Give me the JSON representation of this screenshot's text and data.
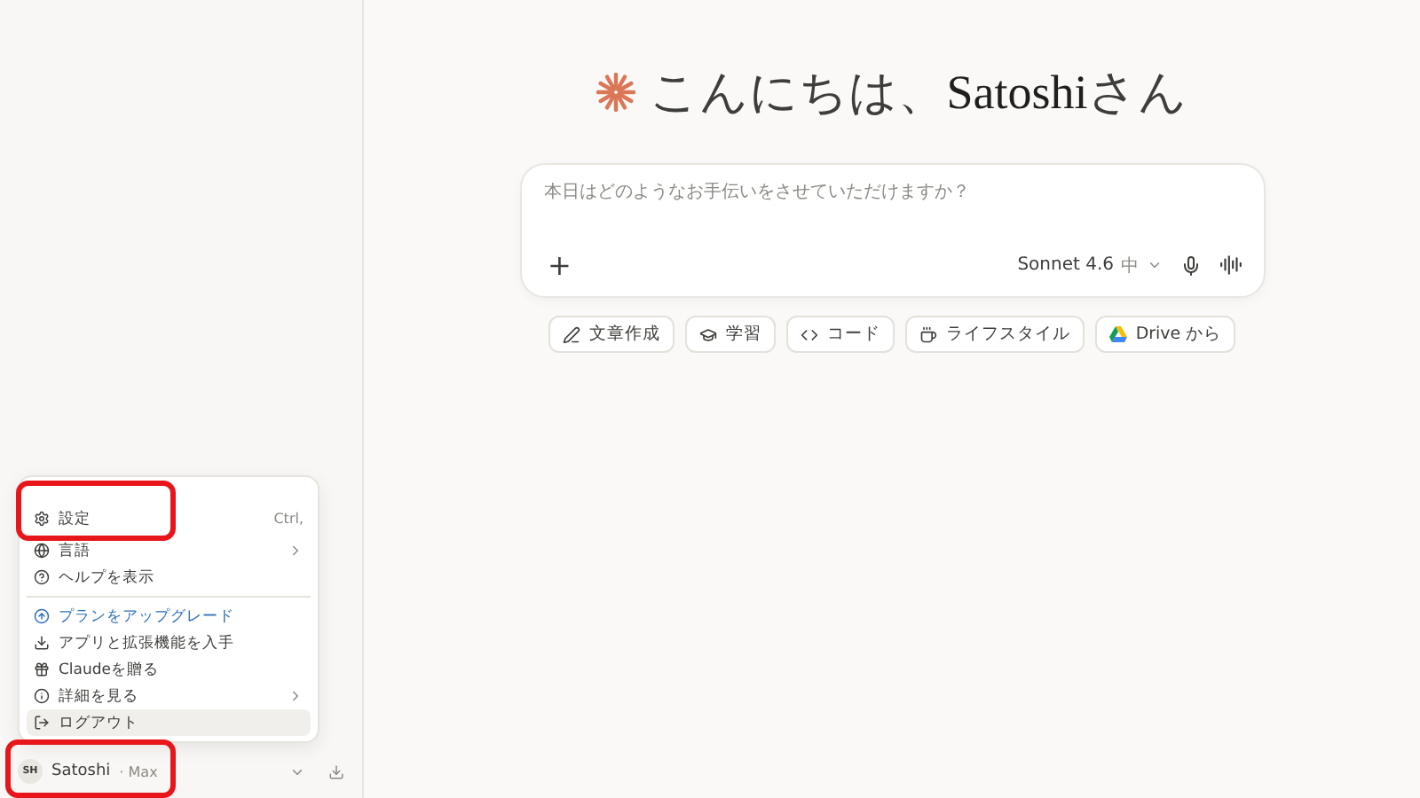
{
  "greeting": {
    "text": "こんにちは、",
    "name": "Satoshi",
    "suffix": "さん"
  },
  "composer": {
    "placeholder": "本日はどのようなお手伝いをさせていただけますか？",
    "plus": "+",
    "model": "Sonnet 4.6",
    "effort": "中"
  },
  "chips": [
    {
      "label": "文章作成"
    },
    {
      "label": "学習"
    },
    {
      "label": "コード"
    },
    {
      "label": "ライフスタイル"
    },
    {
      "label": "Drive から"
    }
  ],
  "menu": {
    "groups": [
      [
        {
          "label": "設定",
          "shortcut": "Ctrl,",
          "submenu": false,
          "accent": false,
          "hovered": false,
          "highlighted": true
        },
        {
          "label": "言語",
          "submenu": true,
          "accent": false,
          "hovered": false,
          "highlighted": false
        },
        {
          "label": "ヘルプを表示",
          "submenu": false,
          "accent": false,
          "hovered": false,
          "highlighted": false
        }
      ],
      [
        {
          "label": "プランをアップグレード",
          "submenu": false,
          "accent": true,
          "hovered": false,
          "highlighted": false
        },
        {
          "label": "アプリと拡張機能を入手",
          "submenu": false,
          "accent": false,
          "hovered": false,
          "highlighted": false
        },
        {
          "label": "Claudeを贈る",
          "submenu": false,
          "accent": false,
          "hovered": false,
          "highlighted": false
        },
        {
          "label": "詳細を見る",
          "submenu": true,
          "accent": false,
          "hovered": false,
          "highlighted": false
        },
        {
          "label": "ログアウト",
          "submenu": false,
          "accent": false,
          "hovered": true,
          "highlighted": false
        }
      ]
    ]
  },
  "user": {
    "initials": "SH",
    "name": "Satoshi",
    "plan": "· Max",
    "highlighted": true
  }
}
